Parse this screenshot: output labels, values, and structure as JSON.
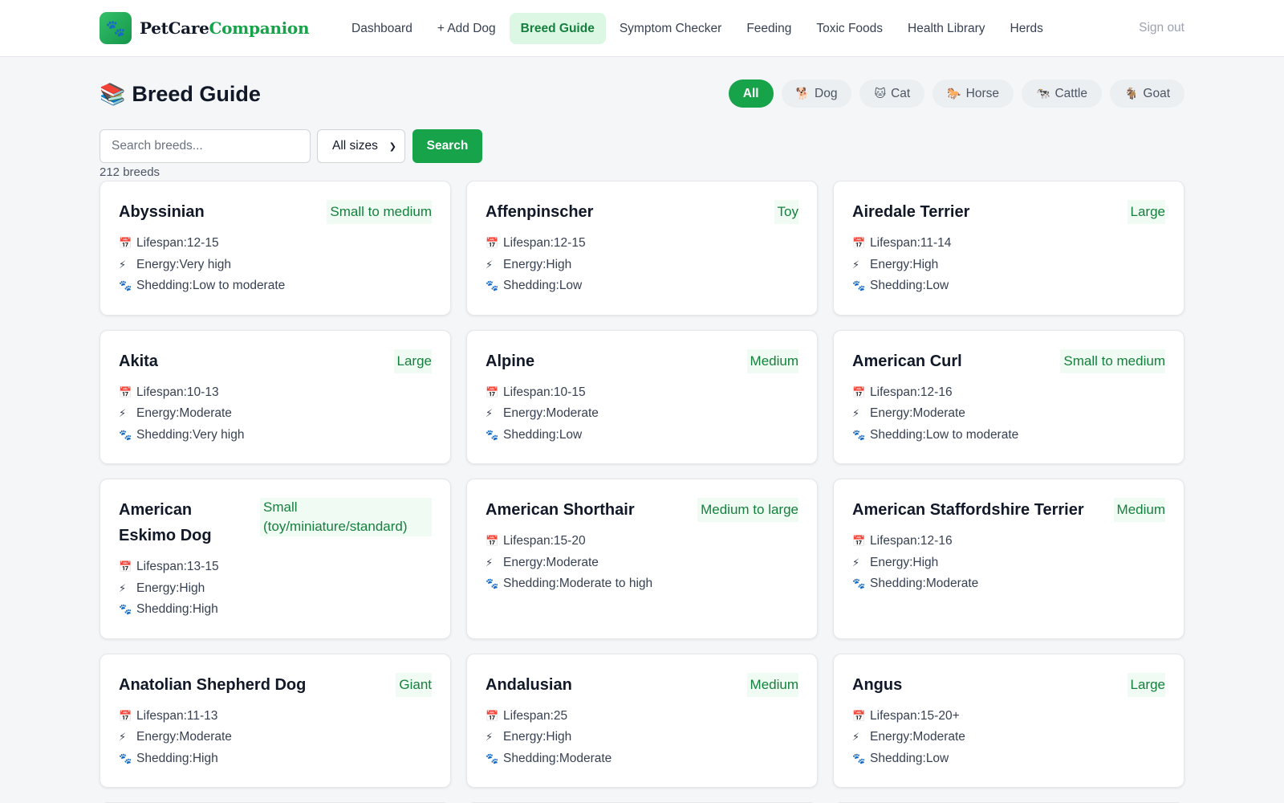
{
  "header": {
    "logo_icon": "paw-icon",
    "brand_part1": "PetCare",
    "brand_part2": "Companion",
    "nav": [
      {
        "label": "Dashboard",
        "active": false
      },
      {
        "label": "+ Add Dog",
        "active": false
      },
      {
        "label": "Breed Guide",
        "active": true
      },
      {
        "label": "Symptom Checker",
        "active": false
      },
      {
        "label": "Feeding",
        "active": false
      },
      {
        "label": "Toxic Foods",
        "active": false
      },
      {
        "label": "Health Library",
        "active": false
      },
      {
        "label": "Herds",
        "active": false
      }
    ],
    "signout_label": "Sign out"
  },
  "page": {
    "title_icon": "📚",
    "title": "Breed Guide",
    "species_filters": [
      {
        "label": "All",
        "icon": "",
        "active": true
      },
      {
        "label": "Dog",
        "icon": "🐕",
        "active": false
      },
      {
        "label": "Cat",
        "icon": "🐱",
        "active": false
      },
      {
        "label": "Horse",
        "icon": "🐎",
        "active": false
      },
      {
        "label": "Cattle",
        "icon": "🐄",
        "active": false
      },
      {
        "label": "Goat",
        "icon": "🐐",
        "active": false
      }
    ]
  },
  "search": {
    "placeholder": "Search breeds...",
    "value": "",
    "size_selected": "All sizes",
    "button_label": "Search"
  },
  "results": {
    "count_label": "212 breeds"
  },
  "labels": {
    "lifespan_prefix": "Lifespan: ",
    "energy_prefix": "Energy: ",
    "shedding_prefix": "Shedding: "
  },
  "icons": {
    "lifespan": "📅",
    "energy": "⚡",
    "shedding": "🐾"
  },
  "colors": {
    "accent": "#16a34a",
    "accent_light": "#dcf7e4",
    "size_text": "#15803d"
  },
  "breeds": [
    {
      "name": "Abyssinian",
      "size": "Small to medium",
      "lifespan": "12-15",
      "energy": "Very high",
      "shedding": "Low to moderate"
    },
    {
      "name": "Affenpinscher",
      "size": "Toy",
      "lifespan": "12-15",
      "energy": "High",
      "shedding": "Low"
    },
    {
      "name": "Airedale Terrier",
      "size": "Large",
      "lifespan": "11-14",
      "energy": "High",
      "shedding": "Low"
    },
    {
      "name": "Akita",
      "size": "Large",
      "lifespan": "10-13",
      "energy": "Moderate",
      "shedding": "Very high"
    },
    {
      "name": "Alpine",
      "size": "Medium",
      "lifespan": "10-15",
      "energy": "Moderate",
      "shedding": "Low"
    },
    {
      "name": "American Curl",
      "size": "Small to medium",
      "lifespan": "12-16",
      "energy": "Moderate",
      "shedding": "Low to moderate"
    },
    {
      "name": "American Eskimo Dog",
      "size": "Small (toy/miniature/standard)",
      "lifespan": "13-15",
      "energy": "High",
      "shedding": "High"
    },
    {
      "name": "American Shorthair",
      "size": "Medium to large",
      "lifespan": "15-20",
      "energy": "Moderate",
      "shedding": "Moderate to high"
    },
    {
      "name": "American Staffordshire Terrier",
      "size": "Medium",
      "lifespan": "12-16",
      "energy": "High",
      "shedding": "Moderate"
    },
    {
      "name": "Anatolian Shepherd Dog",
      "size": "Giant",
      "lifespan": "11-13",
      "energy": "Moderate",
      "shedding": "High"
    },
    {
      "name": "Andalusian",
      "size": "Medium",
      "lifespan": "25",
      "energy": "High",
      "shedding": "Moderate"
    },
    {
      "name": "Angus",
      "size": "Large",
      "lifespan": "15-20+",
      "energy": "Moderate",
      "shedding": "Low"
    }
  ]
}
